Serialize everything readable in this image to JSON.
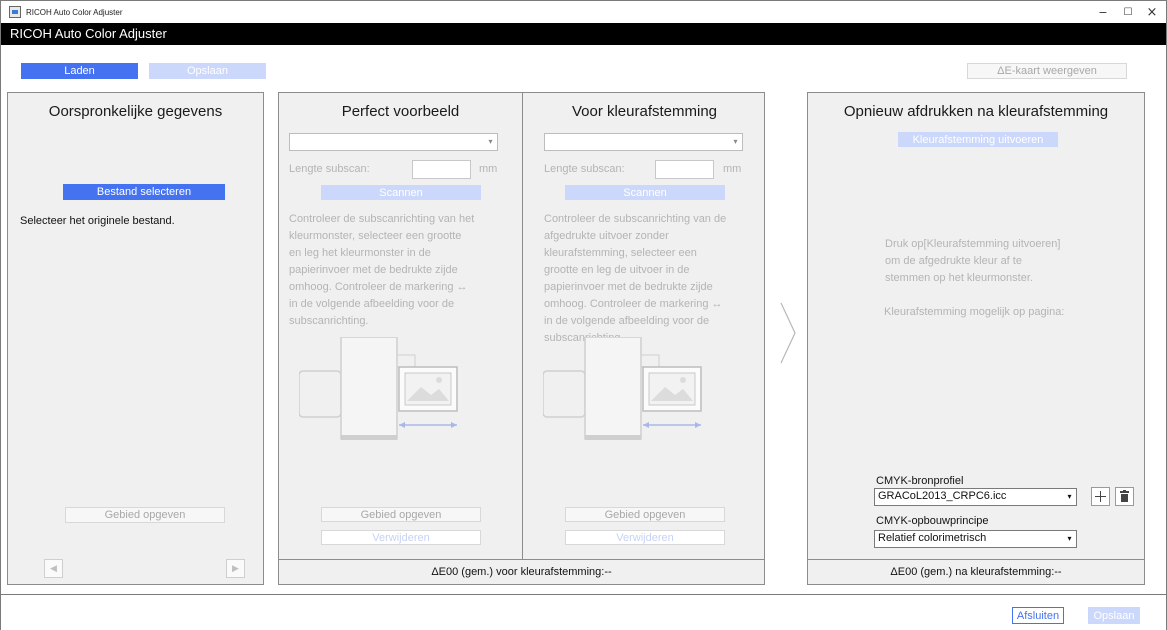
{
  "window": {
    "title": "RICOH Auto Color Adjuster",
    "controls": {
      "minimize": "−",
      "maximize": "☐",
      "close": "×"
    }
  },
  "appbar": {
    "title": "RICOH Auto Color Adjuster"
  },
  "toolbar": {
    "load_label": "Laden",
    "save_label": "Opslaan",
    "de_map_label": "ΔE-kaart weergeven"
  },
  "original": {
    "title": "Oorspronkelijke gegevens",
    "select_file_label": "Bestand selecteren",
    "hint": "Selecteer het originele bestand.",
    "area_label": "Gebied opgeven",
    "prev_icon": "◀",
    "next_icon": "▶"
  },
  "perfect": {
    "title": "Perfect voorbeeld",
    "subscan_label": "Lengte subscan:",
    "subscan_unit": "mm",
    "scan_label": "Scannen",
    "instructions": [
      "Controleer de subscanrichting van het",
      "kleurmonster, selecteer een grootte",
      "en leg het kleurmonster in de",
      "papierinvoer met de bedrukte zijde",
      "omhoog. Controleer de markering ↔",
      "in de volgende afbeelding voor de",
      "subscanrichting."
    ],
    "area_label": "Gebied opgeven",
    "delete_label": "Verwijderen"
  },
  "before": {
    "title": "Voor kleurafstemming",
    "subscan_label": "Lengte subscan:",
    "subscan_unit": "mm",
    "scan_label": "Scannen",
    "instructions": [
      "Controleer de subscanrichting van de",
      "afgedrukte uitvoer zonder",
      "kleurafstemming, selecteer een",
      "grootte en leg de uitvoer in de",
      "papierinvoer met de bedrukte zijde",
      "omhoog. Controleer de markering ↔",
      "in de volgende afbeelding voor de",
      "subscanrichting."
    ],
    "area_label": "Gebied opgeven",
    "delete_label": "Verwijderen"
  },
  "middle_footer": "ΔE00 (gem.) voor kleurafstemming:--",
  "reprint": {
    "title": "Opnieuw afdrukken na kleurafstemming",
    "run_label": "Kleurafstemming uitvoeren",
    "instructions": [
      "Druk op[Kleurafstemming uitvoeren]",
      "om de afgedrukte kleur af te",
      "stemmen op het kleurmonster."
    ],
    "pages_label": "Kleurafstemming mogelijk op pagina:",
    "cmyk_source_label": "CMYK-bronprofiel",
    "cmyk_source_value": "GRACoL2013_CRPC6.icc",
    "cmyk_intent_label": "CMYK-opbouwprincipe",
    "cmyk_intent_value": "Relatief colorimetrisch",
    "footer": "ΔE00 (gem.) na kleurafstemming:--"
  },
  "bottom": {
    "close_label": "Afsluiten",
    "save_label": "Opslaan"
  },
  "colors": {
    "accent": "#4472f0",
    "accent_light": "#ccd8fb",
    "panel_bg": "#f0f0f0",
    "disabled_text": "#b4b4b4"
  }
}
